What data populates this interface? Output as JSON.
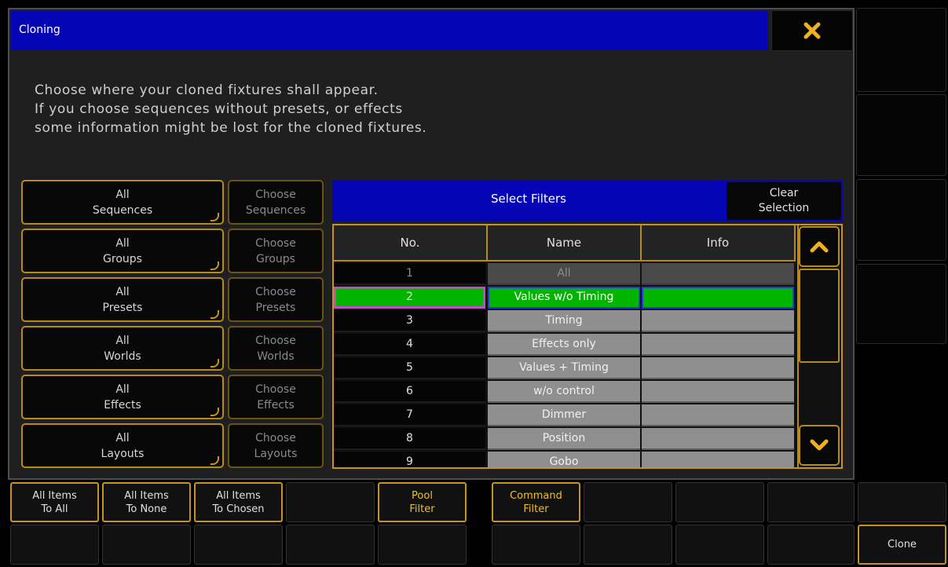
{
  "dialog": {
    "title": "Cloning",
    "close_icon": "close-x-icon",
    "message_lines": [
      "Choose where your cloned fixtures shall appear.",
      "If you choose sequences without presets, or effects",
      "some information might be lost for the cloned fixtures."
    ]
  },
  "categories": [
    {
      "all_line1": "All",
      "all_line2": "Sequences",
      "choose_line1": "Choose",
      "choose_line2": "Sequences"
    },
    {
      "all_line1": "All",
      "all_line2": "Groups",
      "choose_line1": "Choose",
      "choose_line2": "Groups"
    },
    {
      "all_line1": "All",
      "all_line2": "Presets",
      "choose_line1": "Choose",
      "choose_line2": "Presets"
    },
    {
      "all_line1": "All",
      "all_line2": "Worlds",
      "choose_line1": "Choose",
      "choose_line2": "Worlds"
    },
    {
      "all_line1": "All",
      "all_line2": "Effects",
      "choose_line1": "Choose",
      "choose_line2": "Effects"
    },
    {
      "all_line1": "All",
      "all_line2": "Layouts",
      "choose_line1": "Choose",
      "choose_line2": "Layouts"
    }
  ],
  "filters": {
    "title": "Select Filters",
    "clear_line1": "Clear",
    "clear_line2": "Selection",
    "columns": [
      "No.",
      "Name",
      "Info"
    ],
    "rows": [
      {
        "no": "1",
        "name": "All",
        "info": ""
      },
      {
        "no": "2",
        "name": "Values w/o Timing",
        "info": ""
      },
      {
        "no": "3",
        "name": "Timing",
        "info": ""
      },
      {
        "no": "4",
        "name": "Effects only",
        "info": ""
      },
      {
        "no": "5",
        "name": "Values + Timing",
        "info": ""
      },
      {
        "no": "6",
        "name": "w/o control",
        "info": ""
      },
      {
        "no": "7",
        "name": "Dimmer",
        "info": ""
      },
      {
        "no": "8",
        "name": "Position",
        "info": ""
      },
      {
        "no": "9",
        "name": "Gobo",
        "info": ""
      }
    ],
    "selected_row": "2",
    "scroll_up_icon": "chevron-up-icon",
    "scroll_down_icon": "chevron-down-icon"
  },
  "bottom_bar": {
    "all_to_all": [
      "All Items",
      "To All"
    ],
    "all_to_none": [
      "All Items",
      "To None"
    ],
    "all_to_chosen": [
      "All Items",
      "To Chosen"
    ],
    "pool_filter": [
      "Pool",
      "Filter"
    ],
    "command_filter": [
      "Command",
      "Filter"
    ],
    "clone": "Clone"
  },
  "colors": {
    "accent_gold": "#c89418",
    "title_blue": "#0505b6",
    "selected_green": "#00b400"
  }
}
